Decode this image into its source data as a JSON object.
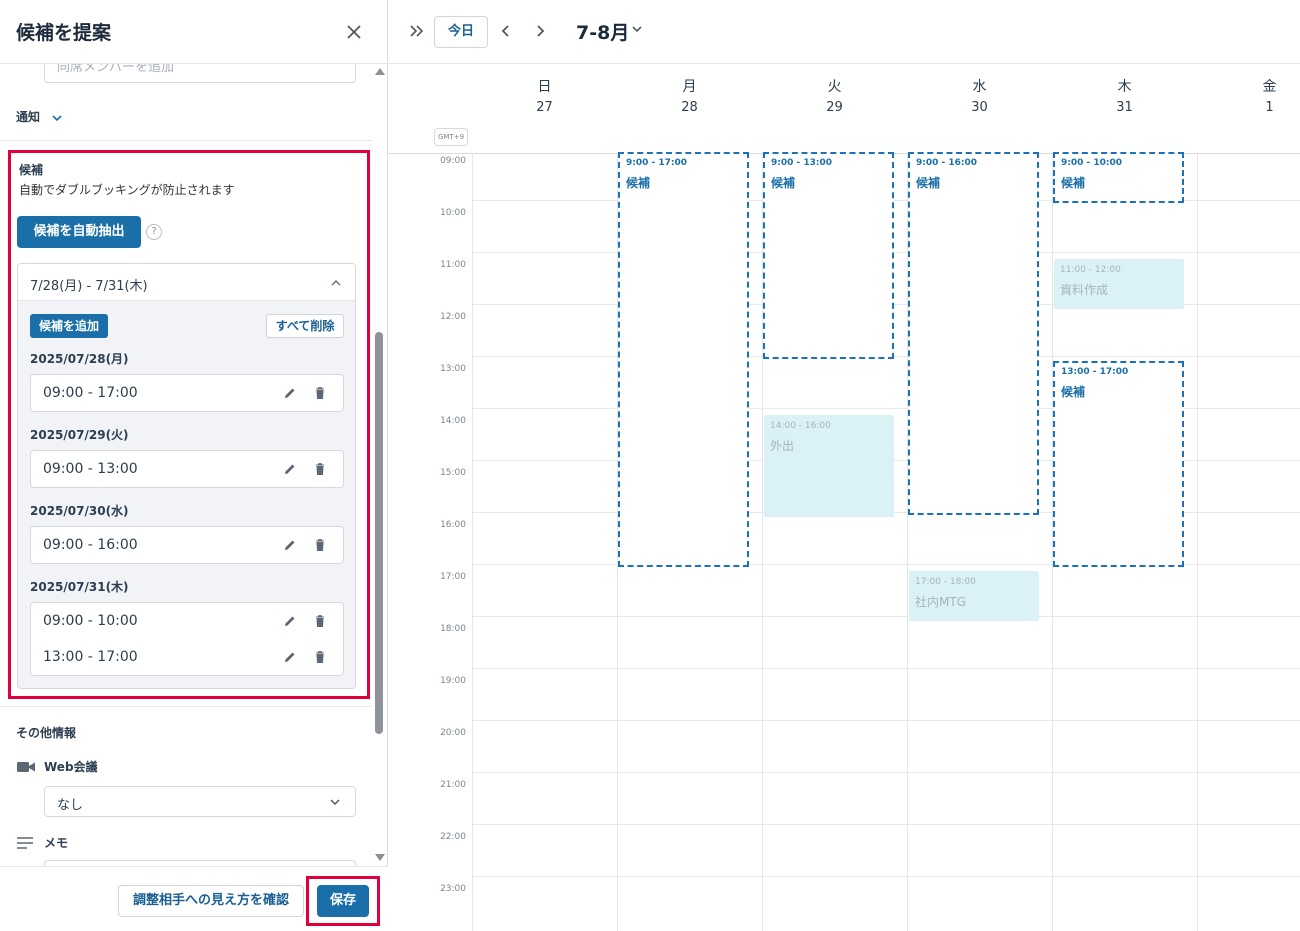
{
  "panel": {
    "title": "候補を提案",
    "member_placeholder": "同席メンバーを追加",
    "notify_label": "通知",
    "candidates": {
      "title": "候補",
      "description": "自動でダブルブッキングが防止されます",
      "auto_button": "候補を自動抽出",
      "help": "?",
      "range_label": "7/28(月) - 7/31(木)",
      "add_button": "候補を追加",
      "delete_all_button": "すべて削除",
      "dates": [
        {
          "date": "2025/07/28(月)",
          "slots": [
            "09:00 - 17:00"
          ]
        },
        {
          "date": "2025/07/29(火)",
          "slots": [
            "09:00 - 13:00"
          ]
        },
        {
          "date": "2025/07/30(水)",
          "slots": [
            "09:00 - 16:00"
          ]
        },
        {
          "date": "2025/07/31(木)",
          "slots": [
            "09:00 - 10:00",
            "13:00 - 17:00"
          ]
        }
      ]
    },
    "other_info": {
      "title": "その他情報",
      "web_meeting_label": "Web会議",
      "web_meeting_value": "なし",
      "memo_label": "メモ"
    },
    "footer": {
      "preview_button": "調整相手への見え方を確認",
      "save_button": "保存"
    }
  },
  "calendar": {
    "today_button": "今日",
    "month_title": "7-8月",
    "timezone": "GMT+9",
    "days": [
      {
        "weekday": "日",
        "day": "27"
      },
      {
        "weekday": "月",
        "day": "28"
      },
      {
        "weekday": "火",
        "day": "29"
      },
      {
        "weekday": "水",
        "day": "30"
      },
      {
        "weekday": "木",
        "day": "31"
      },
      {
        "weekday": "金",
        "day": "1"
      }
    ],
    "hours": [
      "09:00",
      "10:00",
      "11:00",
      "12:00",
      "13:00",
      "14:00",
      "15:00",
      "16:00",
      "17:00",
      "18:00",
      "19:00",
      "20:00",
      "21:00",
      "22:00",
      "23:00"
    ],
    "candidate_blocks": [
      {
        "time": "9:00 - 17:00",
        "label": "候補",
        "day": 1,
        "start": 9,
        "end": 17
      },
      {
        "time": "9:00 - 13:00",
        "label": "候補",
        "day": 2,
        "start": 9,
        "end": 13
      },
      {
        "time": "9:00 - 16:00",
        "label": "候補",
        "day": 3,
        "start": 9,
        "end": 16
      },
      {
        "time": "9:00 - 10:00",
        "label": "候補",
        "day": 4,
        "start": 9,
        "end": 10
      },
      {
        "time": "13:00 - 17:00",
        "label": "候補",
        "day": 4,
        "start": 13,
        "end": 17
      }
    ],
    "busy_events": [
      {
        "time": "11:00 - 12:00",
        "title": "資料作成",
        "day": 4,
        "start": 11,
        "end": 12
      },
      {
        "time": "14:00 - 16:00",
        "title": "外出",
        "day": 2,
        "start": 14,
        "end": 16
      },
      {
        "time": "17:00 - 18:00",
        "title": "社内MTG",
        "day": 3,
        "start": 17,
        "end": 18
      }
    ]
  },
  "colors": {
    "accent": "#1b6fa8",
    "highlight": "#e2003c",
    "busy_bg": "#daf1f6",
    "candidate_border": "#1b72b8"
  }
}
